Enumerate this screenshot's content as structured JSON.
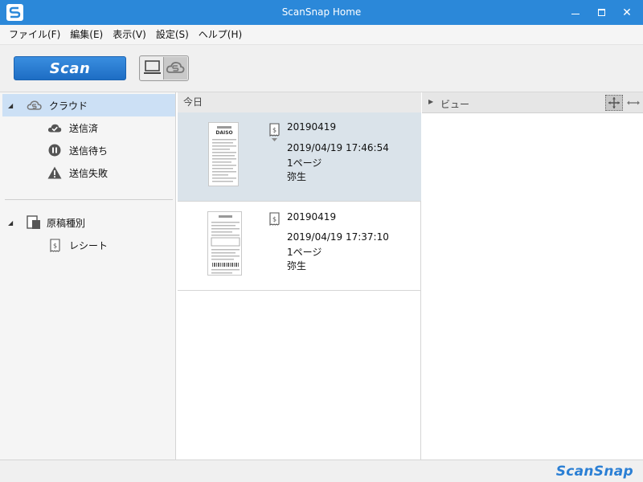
{
  "window": {
    "title": "ScanSnap Home",
    "minimize_label": "",
    "close_label": "✕"
  },
  "menu": [
    "ファイル(F)",
    "編集(E)",
    "表示(V)",
    "設定(S)",
    "ヘルプ(H)"
  ],
  "toolbar": {
    "scan_label": "Scan",
    "mode_selected": "cloud"
  },
  "sidebar": {
    "cloud": {
      "label": "クラウド",
      "items": [
        {
          "label": "送信済",
          "icon": "check-cloud-icon"
        },
        {
          "label": "送信待ち",
          "icon": "pause-icon"
        },
        {
          "label": "送信失敗",
          "icon": "warning-icon"
        }
      ]
    },
    "doctype": {
      "label": "原稿種別",
      "items": [
        {
          "label": "レシート",
          "icon": "receipt-icon"
        }
      ]
    }
  },
  "list": {
    "group_label": "今日",
    "documents": [
      {
        "name": "20190419",
        "datetime": "2019/04/19 17:46:54",
        "pages": "1ページ",
        "app": "弥生",
        "selected": true
      },
      {
        "name": "20190419",
        "datetime": "2019/04/19 17:37:10",
        "pages": "1ページ",
        "app": "弥生",
        "selected": false
      }
    ]
  },
  "viewer": {
    "label": "ビュー"
  },
  "status": {
    "brand": "ScanSnap"
  },
  "colors": {
    "accent": "#2b88d9",
    "selection": "#cce0f5",
    "card_selected": "#dae3ea"
  }
}
